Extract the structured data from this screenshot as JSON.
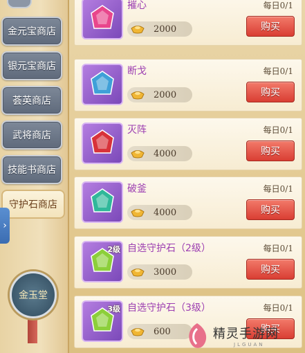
{
  "sidebar": {
    "tabs": [
      {
        "label": "金元宝商店",
        "active": false
      },
      {
        "label": "银元宝商店",
        "active": false
      },
      {
        "label": "荟英商店",
        "active": false
      },
      {
        "label": "武将商店",
        "active": false
      },
      {
        "label": "技能书商店",
        "active": false
      },
      {
        "label": "守护石商店",
        "active": true
      }
    ],
    "expand_icon": "chevron-right-icon",
    "medal_label": "金玉堂"
  },
  "items": [
    {
      "name": "摧心",
      "daily": "每日0/1",
      "price": "2000",
      "buy_label": "购买",
      "gem_color": "#e8468c",
      "icon": "pink-gem-icon"
    },
    {
      "name": "断戈",
      "daily": "每日0/1",
      "price": "2000",
      "buy_label": "购买",
      "gem_color": "#3fa0d8",
      "icon": "blue-gem-icon"
    },
    {
      "name": "灭阵",
      "daily": "每日0/1",
      "price": "4000",
      "buy_label": "购买",
      "gem_color": "#d8323a",
      "icon": "red-gem-icon"
    },
    {
      "name": "破釜",
      "daily": "每日0/1",
      "price": "4000",
      "buy_label": "购买",
      "gem_color": "#30b89a",
      "icon": "green-gem-icon"
    },
    {
      "name": "自选守护石（2级）",
      "daily": "每日0/1",
      "price": "3000",
      "buy_label": "购买",
      "gem_color": "#8ccf3a",
      "level": "2级",
      "icon": "selectable-gem-icon"
    },
    {
      "name": "自选守护石（3级）",
      "daily": "每日0/1",
      "price": "600",
      "buy_label": "购买",
      "gem_color": "#8ccf3a",
      "level": "3级",
      "icon": "selectable-gem-icon"
    }
  ],
  "colors": {
    "accent_purple": "#9c3eb1",
    "buy_red": "#d93e33"
  },
  "watermark": {
    "cn": "精灵手游网",
    "en": "JLGUAN"
  }
}
